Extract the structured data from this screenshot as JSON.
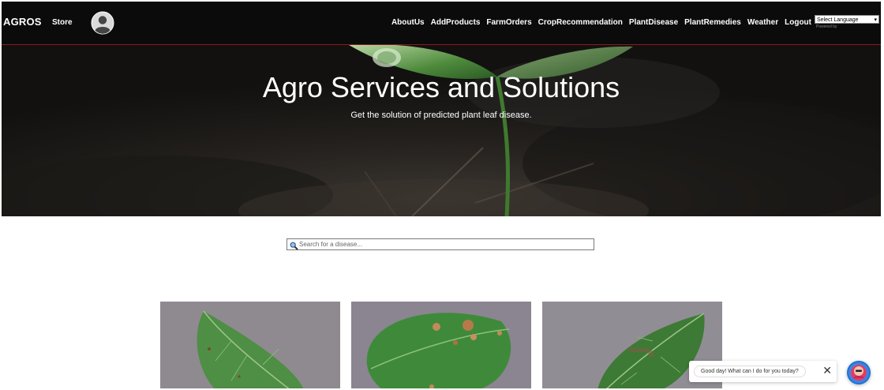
{
  "nav": {
    "brand": "AGROS",
    "store": "Store",
    "links": [
      "AboutUs",
      "AddProducts",
      "FarmOrders",
      "CropRecommendation",
      "PlantDisease",
      "PlantRemedies",
      "Weather",
      "Logout"
    ],
    "language": "Select Language",
    "powered_by": "Powered by"
  },
  "hero": {
    "title": "Agro Services and Solutions",
    "subtitle": "Get the solution of predicted plant leaf disease."
  },
  "search": {
    "placeholder": "Search for a disease..."
  },
  "chat": {
    "message": "Good day! What can I do for you today?",
    "close": "✕"
  },
  "colors": {
    "navbar": "#0c0b0c",
    "nav_border": "#8b1a1a",
    "chat_launcher": "#1e73d6"
  },
  "icons": {
    "avatar": "user-avatar-icon",
    "search": "magnifier-icon",
    "chat": "chatbot-icon",
    "close": "close-icon"
  }
}
